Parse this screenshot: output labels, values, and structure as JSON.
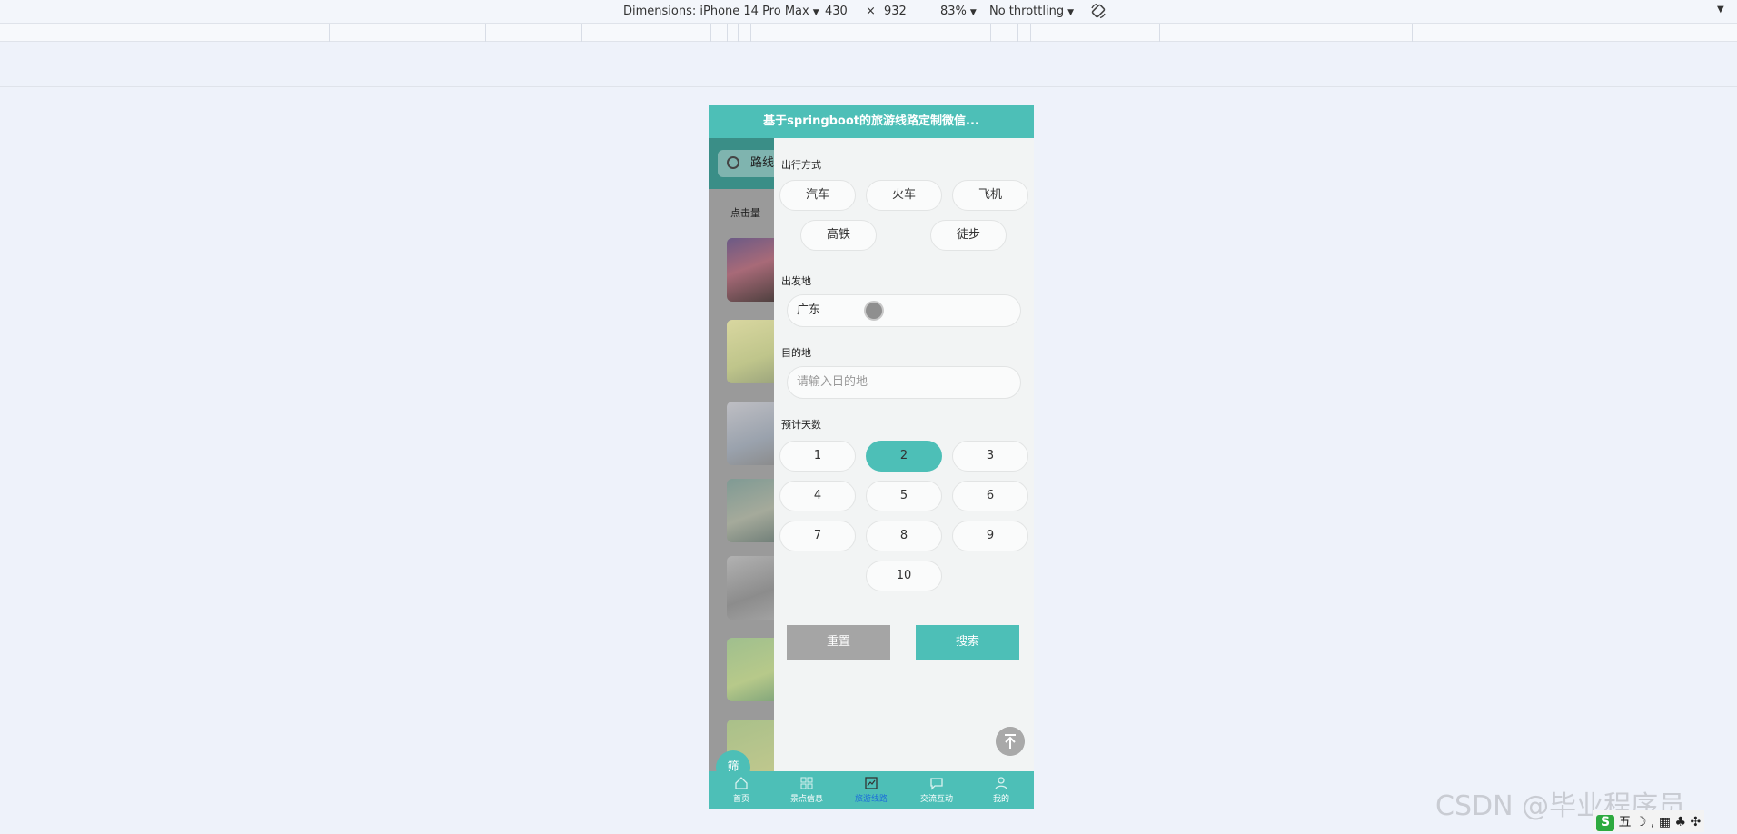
{
  "devtools": {
    "dimensions_label": "Dimensions: iPhone 14 Pro Max",
    "width": "430",
    "times": "×",
    "height": "932",
    "zoom": "83%",
    "throttling": "No throttling"
  },
  "app": {
    "title": "基于springboot的旅游线路定制微信...",
    "background": {
      "search_text": "路线",
      "click_label": "点击量"
    },
    "fab_label": "筛",
    "filter": {
      "travel_mode": {
        "label": "出行方式",
        "options": [
          "汽车",
          "火车",
          "飞机",
          "高铁",
          "徒步"
        ]
      },
      "origin": {
        "label": "出发地",
        "value": "广东"
      },
      "destination": {
        "label": "目的地",
        "placeholder": "请输入目的地"
      },
      "days": {
        "label": "预计天数",
        "options": [
          "1",
          "2",
          "3",
          "4",
          "5",
          "6",
          "7",
          "8",
          "9",
          "10"
        ],
        "selected": "2"
      },
      "reset_label": "重置",
      "search_label": "搜索"
    },
    "tabbar": [
      "首页",
      "景点信息",
      "旅游线路",
      "交流互动",
      "我的"
    ],
    "active_tab": "旅游线路"
  },
  "watermark": "CSDN @毕业程序员",
  "ime": {
    "logo": "S",
    "text": "五"
  },
  "colors": {
    "primary": "#4dbfb7",
    "reset_button": "#a5a5a5",
    "active_tab": "#1e6fd9"
  }
}
